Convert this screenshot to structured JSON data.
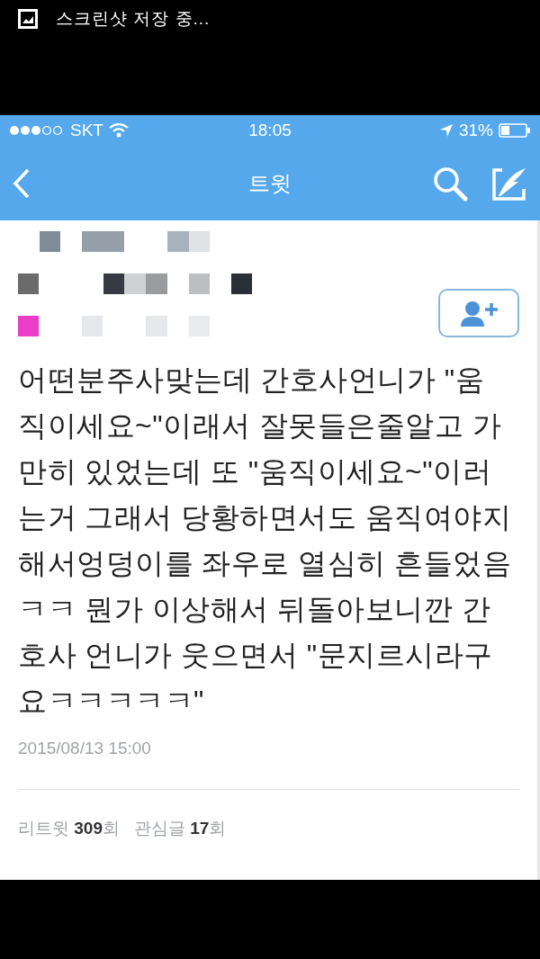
{
  "notification": {
    "text": "스크린샷 저장 중..."
  },
  "status_bar": {
    "carrier": "SKT",
    "time": "18:05",
    "battery": "31%"
  },
  "nav": {
    "title": "트윗"
  },
  "tweet": {
    "text": "어떤분주사맞는데 간호사언니가 \"움직이세요~\"이래서 잘못들은줄알고 가만히 있었는데 또 \"움직이세요~\"이러는거 그래서 당황하면서도 움직여야지해서엉덩이를 좌우로 열심히 흔들었음ㅋㅋ 뭔가 이상해서 뒤돌아보니깐 간호사 언니가 웃으면서 \"문지르시라구요ㅋㅋㅋㅋㅋ\"",
    "timestamp": "2015/08/13 15:00",
    "stats": [
      "리트윗 **309**회",
      "관심글 **17**회"
    ]
  }
}
